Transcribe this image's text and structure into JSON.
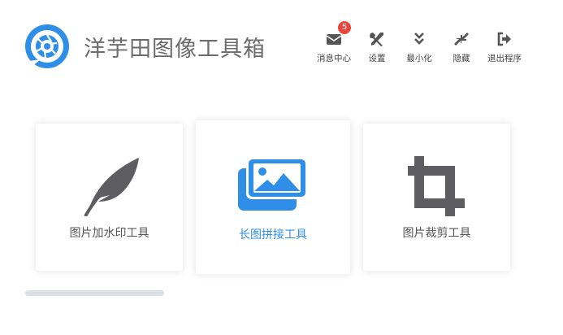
{
  "app": {
    "title": "洋芋田图像工具箱",
    "accent_color": "#2f8fe8"
  },
  "toolbar": {
    "items": [
      {
        "label": "消息中心",
        "icon": "envelope-icon",
        "badge": "5"
      },
      {
        "label": "设置",
        "icon": "tools-icon"
      },
      {
        "label": "最小化",
        "icon": "double-chevron-down-icon"
      },
      {
        "label": "隐藏",
        "icon": "compress-icon"
      },
      {
        "label": "退出程序",
        "icon": "sign-out-icon"
      }
    ]
  },
  "tools": [
    {
      "label": "图片加水印工具",
      "icon": "feather-icon",
      "active": false
    },
    {
      "label": "长图拼接工具",
      "icon": "images-icon",
      "active": true
    },
    {
      "label": "图片裁剪工具",
      "icon": "crop-icon",
      "active": false
    }
  ]
}
